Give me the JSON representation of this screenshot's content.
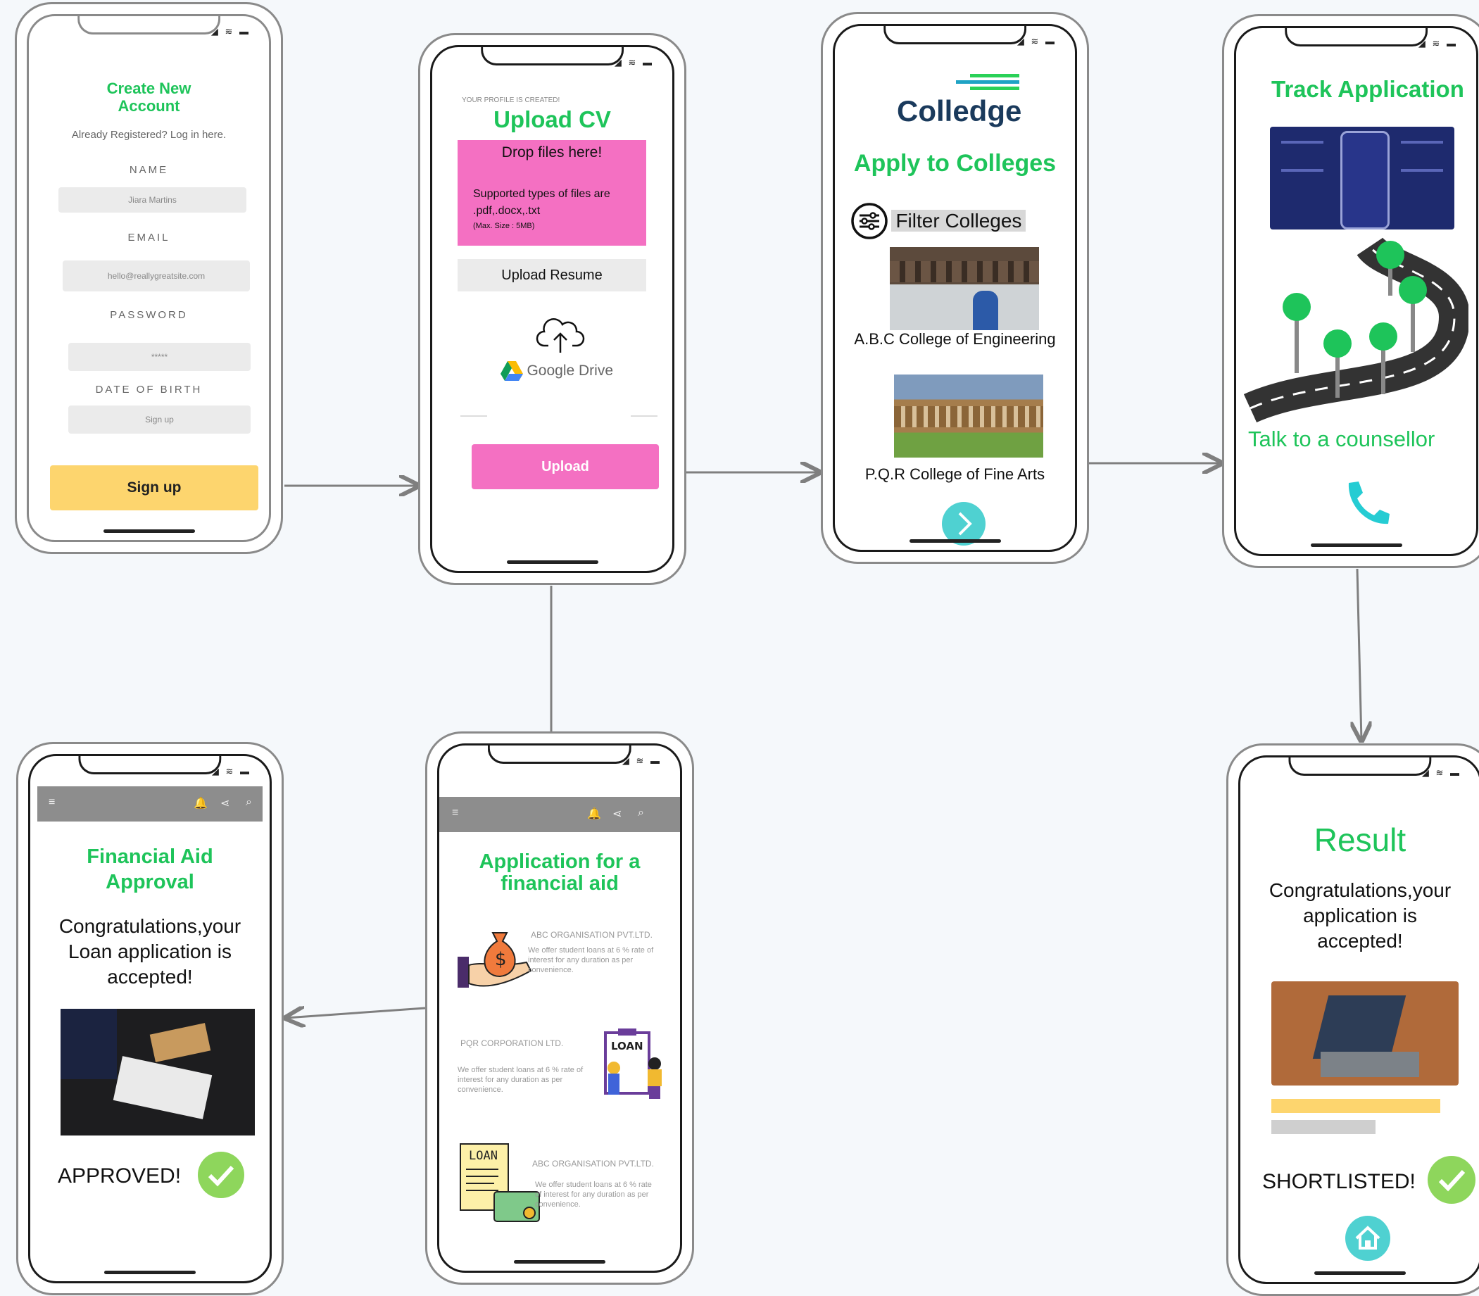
{
  "status_icons": "◢ ≋ ▬",
  "signup": {
    "title_line1": "Create New",
    "title_line2": "Account",
    "already": "Already Registered? Log in here.",
    "name_label": "NAME",
    "name_value": "Jiara Martins",
    "email_label": "EMAIL",
    "email_value": "hello@reallygreatsite.com",
    "password_label": "PASSWORD",
    "password_value": "*****",
    "dob_label": "DATE OF BIRTH",
    "dob_value": "Sign up",
    "button": "Sign up",
    "button_color": "#fdd56e"
  },
  "upload": {
    "eyebrow": "YOUR PROFILE IS CREATED!",
    "title": "Upload CV",
    "drop": "Drop files here!",
    "types_line1": "Supported types of files are",
    "types_line2": ".pdf,.docx,.txt",
    "max_size": "(Max. Size : 5MB)",
    "resume_button": "Upload Resume",
    "drive_label": "Google Drive",
    "upload_button": "Upload",
    "pink": "#f470c2"
  },
  "colleges": {
    "logo": "Colledge",
    "title": "Apply to Colleges",
    "filter": "Filter Colleges",
    "college1": "A.B.C College of Engineering",
    "college2": "P.Q.R College of Fine Arts"
  },
  "track": {
    "title": "Track Application",
    "counsellor": "Talk to a counsellor"
  },
  "result": {
    "title": "Result",
    "message_line1": "Congratulations,your",
    "message_line2": "application is",
    "message_line3": "accepted!",
    "shortlisted": "SHORTLISTED!"
  },
  "aid_application": {
    "title_line1": "Application for a",
    "title_line2": "financial aid",
    "org1_name": "ABC ORGANISATION PVT.LTD.",
    "org1_desc": "We offer student loans at 6 % rate of interest for any duration as per convenience.",
    "org2_name": "PQR CORPORATION LTD.",
    "org2_desc": "We offer student loans at 6 % rate of interest for any duration as per convenience.",
    "org3_name": "ABC ORGANISATION PVT.LTD.",
    "org3_desc": "We offer student loans at 6 % rate of interest for any duration as per convenience.",
    "loan_label": "LOAN"
  },
  "aid_approval": {
    "title_line1": "Financial Aid",
    "title_line2": "Approval",
    "message_line1": "Congratulations,your",
    "message_line2": "Loan application is",
    "message_line3": "accepted!",
    "approved": "APPROVED!"
  },
  "colors": {
    "accent_green": "#1ec45a",
    "teal": "#4fd1d1",
    "pink": "#f470c2",
    "yellow": "#fdd56e"
  }
}
